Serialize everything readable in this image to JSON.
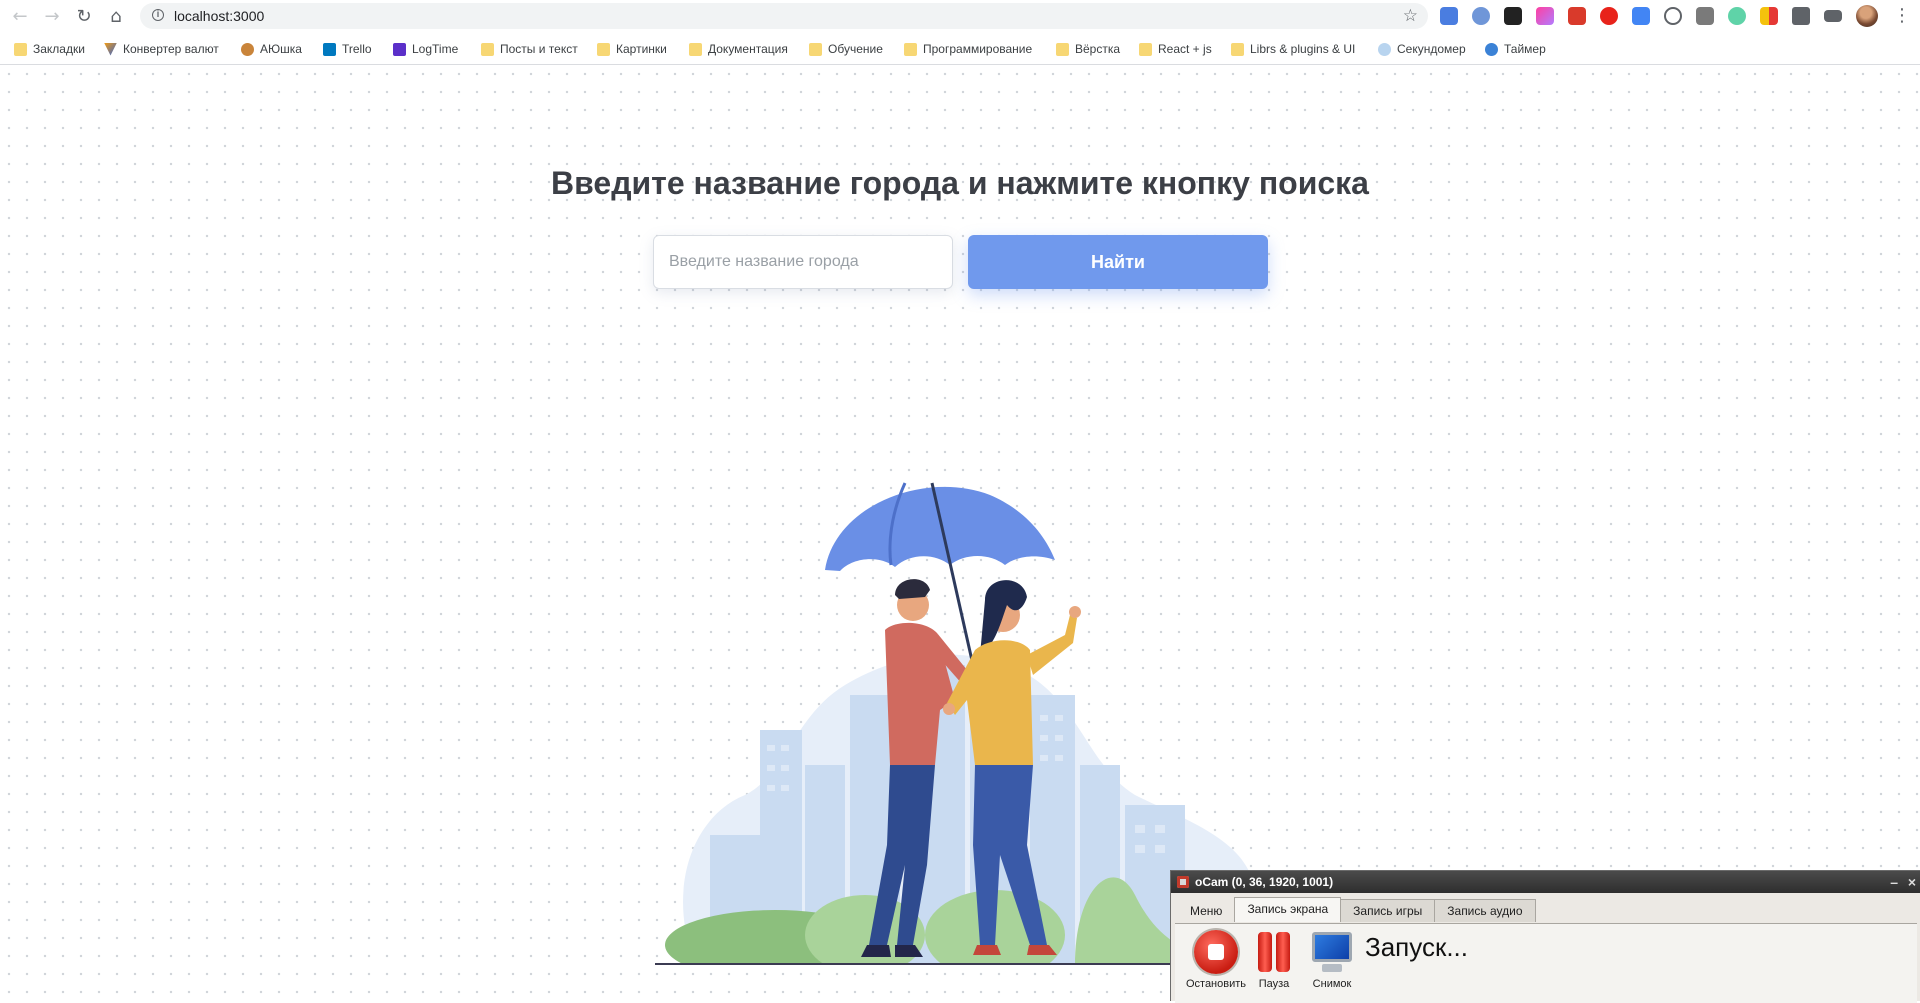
{
  "browser": {
    "url": "localhost:3000",
    "bookmarks": [
      {
        "label": "Закладки",
        "icon": "folder-icon"
      },
      {
        "label": "Конвертер валют",
        "icon": "converter-icon"
      },
      {
        "label": "АЮшка",
        "icon": "ayushka-icon"
      },
      {
        "label": "Trello",
        "icon": "trello-icon"
      },
      {
        "label": "LogTime",
        "icon": "logtime-icon"
      },
      {
        "label": "Посты и текст",
        "icon": "folder-icon"
      },
      {
        "label": "Картинки",
        "icon": "folder-icon"
      },
      {
        "label": "Документация",
        "icon": "folder-icon"
      },
      {
        "label": "Обучение",
        "icon": "folder-icon"
      },
      {
        "label": "Программирование",
        "icon": "folder-icon"
      },
      {
        "label": "Вёрстка",
        "icon": "folder-icon"
      },
      {
        "label": "React + js",
        "icon": "folder-icon"
      },
      {
        "label": "Librs & plugins & UI",
        "icon": "folder-icon"
      },
      {
        "label": "Секундомер",
        "icon": "stopwatch-icon"
      },
      {
        "label": "Таймер",
        "icon": "timer-icon"
      }
    ]
  },
  "main": {
    "heading": "Введите название города и нажмите кнопку поиска",
    "search_placeholder": "Введите название города",
    "search_button": "Найти"
  },
  "ocam": {
    "title": "oCam (0, 36, 1920, 1001)",
    "tabs": [
      "Меню",
      "Запись экрана",
      "Запись игры",
      "Запись аудио"
    ],
    "active_tab": "Запись экрана",
    "tools": [
      "Остановить",
      "Пауза",
      "Снимок"
    ],
    "status": "Запуск..."
  },
  "colors": {
    "accent": "#7099ed",
    "heading": "#3c3f46"
  }
}
